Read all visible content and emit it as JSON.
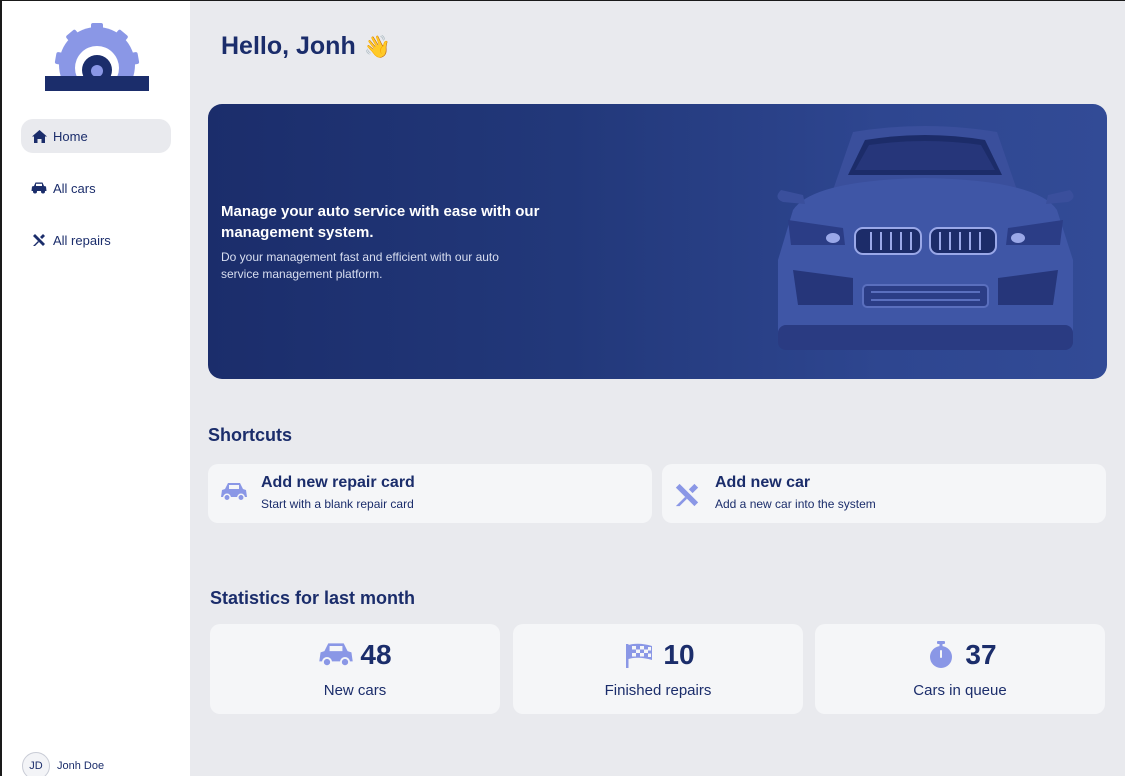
{
  "user": {
    "greeting": "Hello, Jonh",
    "wave_emoji": "👋",
    "initials": "JD",
    "name": "Jonh Doe"
  },
  "sidebar": {
    "logo_icon": "gear-garage-icon",
    "items": [
      {
        "label": "Home",
        "icon": "home-icon",
        "active": true
      },
      {
        "label": "All cars",
        "icon": "car-icon",
        "active": false
      },
      {
        "label": "All repairs",
        "icon": "tools-icon",
        "active": false
      }
    ]
  },
  "hero": {
    "title": "Manage your auto service with ease with our management system.",
    "subtitle": "Do your management fast and efficient with our auto service management platform."
  },
  "shortcuts": {
    "title": "Shortcuts",
    "items": [
      {
        "title": "Add new repair card",
        "subtitle": "Start with a blank repair card",
        "icon": "car-icon"
      },
      {
        "title": "Add new car",
        "subtitle": "Add a new car into the system",
        "icon": "tools-icon"
      }
    ]
  },
  "stats": {
    "title": "Statistics for last month",
    "items": [
      {
        "value": "48",
        "label": "New cars",
        "icon": "car-icon"
      },
      {
        "value": "10",
        "label": "Finished repairs",
        "icon": "checkered-flag-icon"
      },
      {
        "value": "37",
        "label": "Cars in queue",
        "icon": "stopwatch-icon"
      }
    ]
  },
  "colors": {
    "primary": "#1b2d6b",
    "accent": "#8a97e6",
    "background": "#e9eaee",
    "card": "#f5f6f8"
  }
}
